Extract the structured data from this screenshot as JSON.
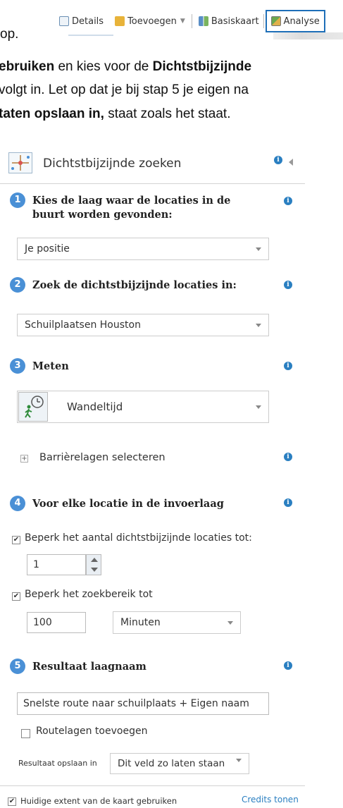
{
  "toolbar": {
    "details_label": "Details",
    "add_label": "Toevoegen",
    "basemap_label": "Basiskaart",
    "analysis_label": "Analyse"
  },
  "instructions": {
    "line1_frag": "op.",
    "line2_bold_a": "ebruiken",
    "line2_text_a": " en kies voor de ",
    "line2_bold_b": "Dichtstbijzijnde",
    "line3_text": "volgt in. Let op dat je bij stap 5 je eigen na",
    "line4_bold": "taten opslaan in,",
    "line4_text": " staat zoals het staat."
  },
  "panel": {
    "title": "Dichtstbijzijnde zoeken",
    "step1": {
      "number": "1",
      "label": "Kies de laag waar de locaties in de buurt worden gevonden:",
      "value": "Je positie"
    },
    "step2": {
      "number": "2",
      "label": "Zoek de dichtstbijzijnde locaties in:",
      "value": "Schuilplaatsen Houston"
    },
    "step3": {
      "number": "3",
      "label": "Meten",
      "value": "Wandeltijd"
    },
    "barriers_label": "Barrièrelagen selecteren",
    "step4": {
      "number": "4",
      "label": "Voor elke locatie in de invoerlaag",
      "limit_count_label": "Beperk het aantal dichtstbijzijnde locaties tot:",
      "limit_count_value": "1",
      "limit_range_label": "Beperk het zoekbereik tot",
      "limit_range_value": "100",
      "limit_range_unit": "Minuten"
    },
    "step5": {
      "number": "5",
      "label": "Resultaat laagnaam",
      "value": "Snelste route naar schuilplaats + Eigen naam",
      "route_layers_label": "Routelagen toevoegen",
      "save_in_label": "Resultaat opslaan in",
      "save_in_value": "Dit veld zo laten staan"
    },
    "extent_label": "Huidige extent van de kaart gebruiken",
    "credits_label": "Credits tonen"
  },
  "colors": {
    "accent": "#2a7fc1",
    "step_circle": "#4a90d6",
    "analysis_border": "#1e6fb8"
  }
}
